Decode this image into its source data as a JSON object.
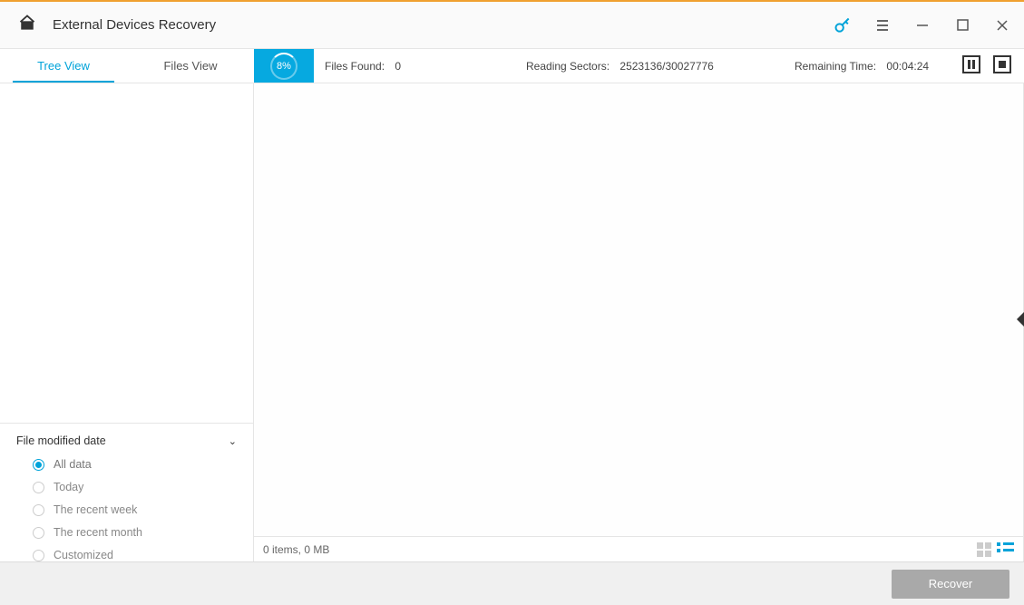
{
  "titlebar": {
    "title": "External Devices Recovery"
  },
  "tabs": {
    "tree_view": "Tree View",
    "files_view": "Files View",
    "active": "tree_view"
  },
  "progress": {
    "percent": "8%"
  },
  "status": {
    "files_found_label": "Files Found:",
    "files_found_value": "0",
    "reading_sectors_label": "Reading Sectors:",
    "reading_sectors_value": "2523136/30027776",
    "remaining_time_label": "Remaining Time:",
    "remaining_time_value": "00:04:24"
  },
  "filter": {
    "heading": "File modified date",
    "options": [
      {
        "label": "All data",
        "selected": true
      },
      {
        "label": "Today",
        "selected": false
      },
      {
        "label": "The recent week",
        "selected": false
      },
      {
        "label": "The recent month",
        "selected": false
      },
      {
        "label": "Customized",
        "selected": false
      }
    ]
  },
  "content_footer": {
    "summary": "0 items, 0 MB"
  },
  "footer": {
    "recover_label": "Recover"
  }
}
